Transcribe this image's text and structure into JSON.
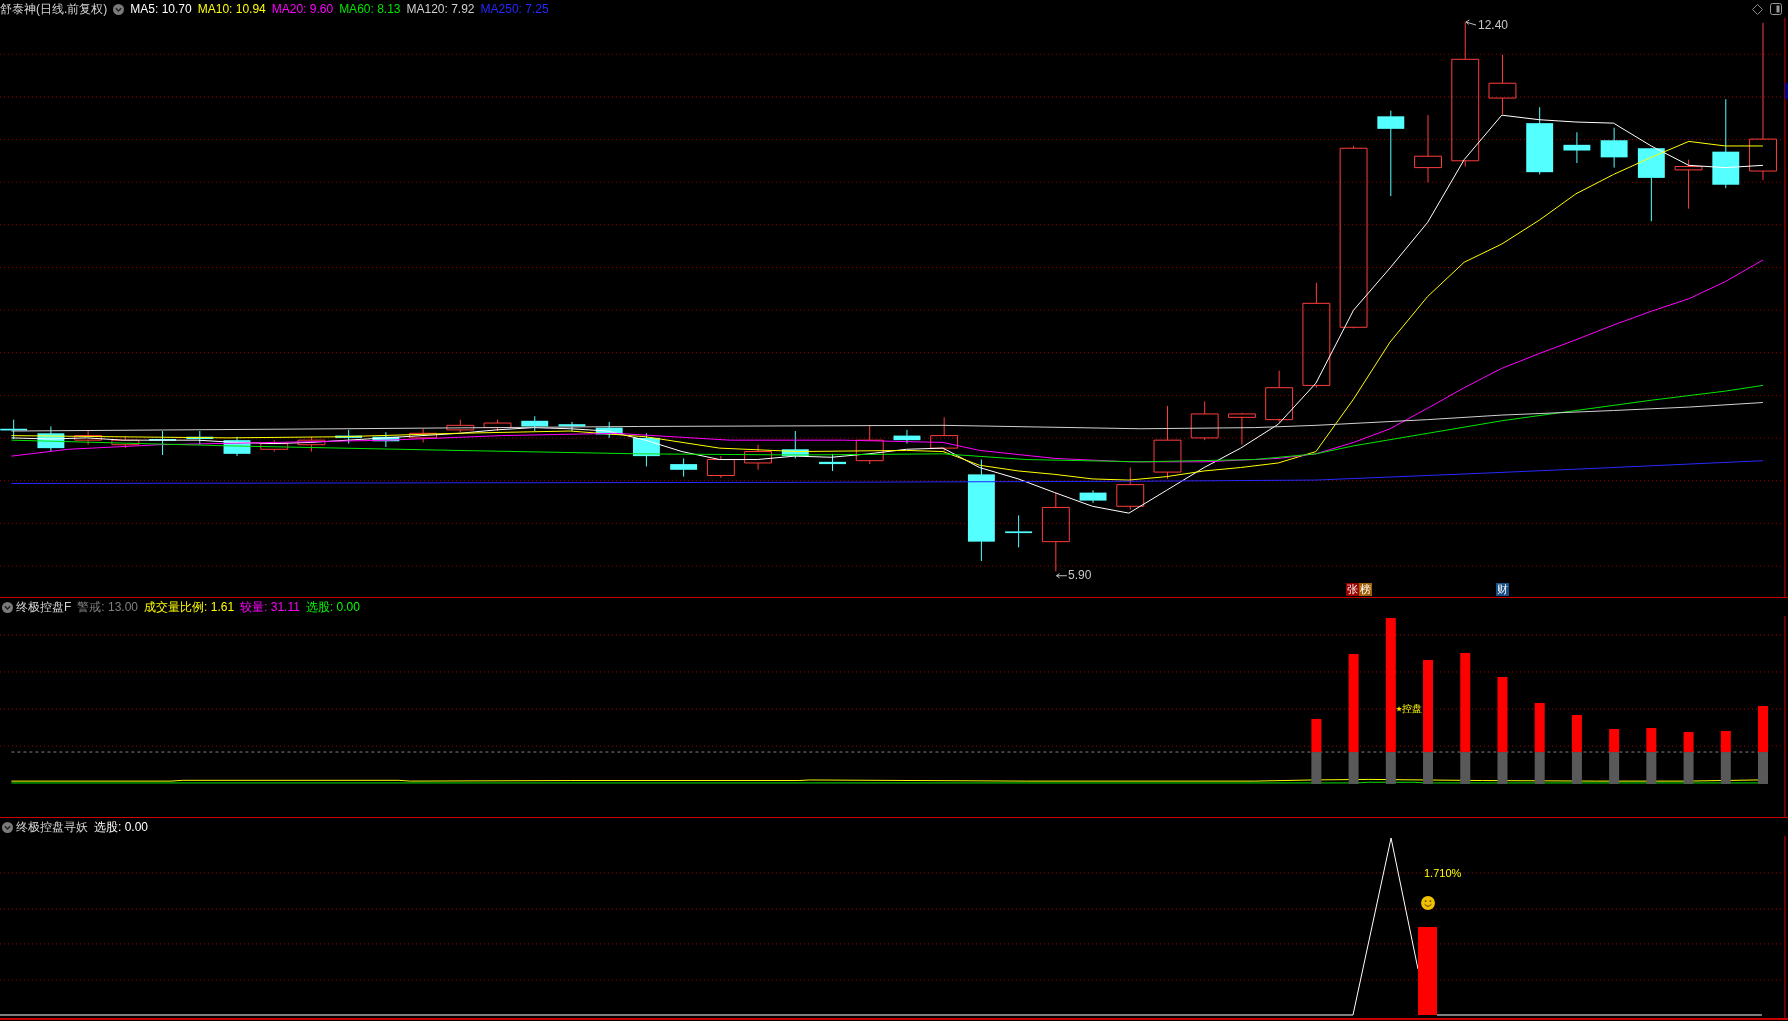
{
  "main_panel": {
    "title": "舒泰神(日线.前复权)",
    "indicators": [
      {
        "label": "MA5: 10.70",
        "color": "#ffffff"
      },
      {
        "label": "MA10: 10.94",
        "color": "#ffff00"
      },
      {
        "label": "MA20: 9.60",
        "color": "#ff00ff"
      },
      {
        "label": "MA60: 8.13",
        "color": "#00e600"
      },
      {
        "label": "MA120: 7.92",
        "color": "#d0d0d0"
      },
      {
        "label": "MA250: 7.25",
        "color": "#2828ff"
      }
    ],
    "high_label": "12.40",
    "low_label": "5.90",
    "event_tags": [
      {
        "text": "张",
        "color": "#9a0000"
      },
      {
        "text": "榜",
        "color": "#a0600a"
      },
      {
        "text": "财",
        "color": "#1a4f85"
      }
    ]
  },
  "control_panel": {
    "title": "终极控盘F",
    "indicators": [
      {
        "label": "警戒: 13.00",
        "color": "#808080"
      },
      {
        "label": "成交量比例: 1.61",
        "color": "#ffff00"
      },
      {
        "label": "较量: 31.11",
        "color": "#ff00ff"
      },
      {
        "label": "选股: 0.00",
        "color": "#00ff00"
      }
    ],
    "note": "控盘"
  },
  "signal_panel": {
    "title": "终极控盘寻妖",
    "reading": "选股: 0.00",
    "note": "1.710%"
  }
}
